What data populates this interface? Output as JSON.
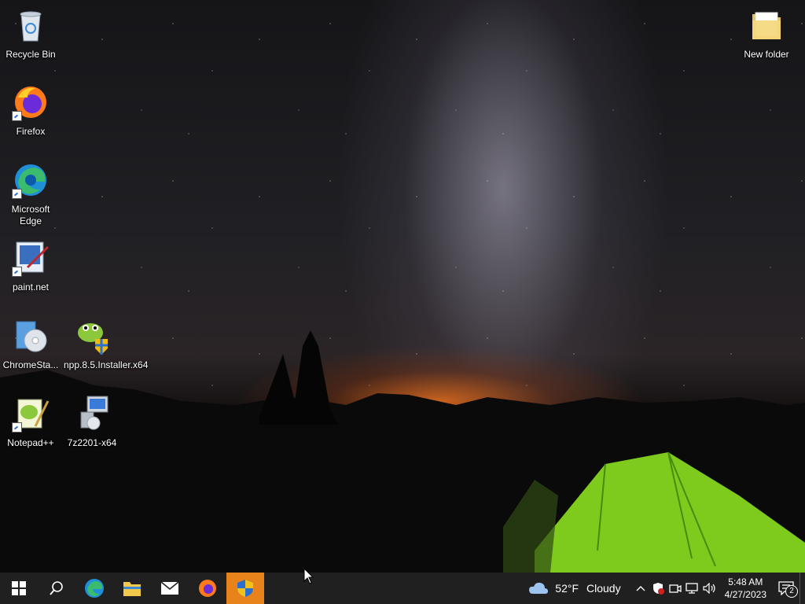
{
  "desktop": {
    "icons": [
      {
        "label": "Recycle Bin"
      },
      {
        "label": "Firefox"
      },
      {
        "label": "Microsoft Edge"
      },
      {
        "label": "paint.net"
      },
      {
        "label": "ChromeSta..."
      },
      {
        "label": "npp.8.5.Installer.x64"
      },
      {
        "label": "Notepad++"
      },
      {
        "label": "7z2201-x64"
      },
      {
        "label": "New folder"
      }
    ]
  },
  "taskbar": {
    "apps": [
      "start-icon",
      "search-icon",
      "edge-icon",
      "file-explorer-icon",
      "mail-icon",
      "firefox-icon",
      "security-shield-icon"
    ],
    "active_index": 6,
    "weather": {
      "temperature": "52°F",
      "condition": "Cloudy"
    },
    "clock": {
      "time": "5:48 AM",
      "date": "4/27/2023"
    },
    "notifications_count": "2"
  },
  "colors": {
    "taskbar": "#202020",
    "active_app": "#e8831c",
    "accent": "#0078d7"
  }
}
